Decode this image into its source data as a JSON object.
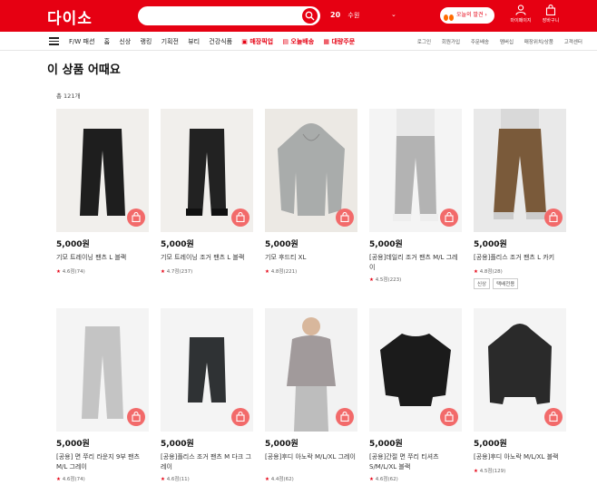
{
  "header": {
    "logo": "다이소",
    "search": {
      "placeholder": ""
    },
    "weather": {
      "temp": "20",
      "location": "수원"
    },
    "promo_label": "오늘의 발견",
    "tools": [
      {
        "label": "마이페이지",
        "icon": "user-icon"
      },
      {
        "label": "장바구니",
        "icon": "bag-icon"
      }
    ]
  },
  "nav": {
    "items": [
      "F/W 패션",
      "홈",
      "신상",
      "랭킹",
      "기획전",
      "뷰티",
      "건강식품"
    ],
    "special": [
      "매장픽업",
      "오늘배송",
      "대량주문"
    ],
    "utility": [
      "로그인",
      "회원가입",
      "주문배송",
      "멤버십",
      "매장위치/상품",
      "고객센터"
    ]
  },
  "section": {
    "title": "이 상품 어때요",
    "count": "총 121개"
  },
  "products": [
    {
      "price": "5,000원",
      "name": "기모 트레이닝 팬츠 L 블랙",
      "rating": "4.6점(74)",
      "image": "black-pants",
      "tags": []
    },
    {
      "price": "5,000원",
      "name": "기모 트레이닝 조거 팬츠 L 블랙",
      "rating": "4.7점(237)",
      "image": "black-jogger",
      "tags": []
    },
    {
      "price": "5,000원",
      "name": "기모 후드티 XL",
      "rating": "4.8점(221)",
      "image": "grey-hoodie",
      "tags": []
    },
    {
      "price": "5,000원",
      "name": "[공용]데일리 조거 팬츠 M/L 그레이",
      "rating": "4.5점(223)",
      "image": "grey-jogger-model",
      "tags": []
    },
    {
      "price": "5,000원",
      "name": "[공용]플리스 조거 팬츠 L 카키",
      "rating": "4.8점(28)",
      "image": "khaki-fleece-model",
      "tags": [
        "신상",
        "택배전용"
      ]
    },
    {
      "price": "5,000원",
      "name": "[공용] 면 쭈리 라운지 9부 팬츠 M/L 그레이",
      "rating": "4.6점(74)",
      "image": "grey-lounge-pants",
      "tags": []
    },
    {
      "price": "5,000원",
      "name": "[공용]플리스 조거 팬츠 M 다크 그레이",
      "rating": "4.6점(11)",
      "image": "dark-fleece-pants",
      "tags": []
    },
    {
      "price": "5,000원",
      "name": "[공용]후디 아노락 M/L/XL 그레이",
      "rating": "4.4점(62)",
      "image": "grey-anorak-model",
      "tags": []
    },
    {
      "price": "5,000원",
      "name": "[공용]간절 면 쭈리 티셔츠 S/M/L/XL 블랙",
      "rating": "4.6점(62)",
      "image": "black-tshirt",
      "tags": []
    },
    {
      "price": "5,000원",
      "name": "[공용]후디 아노락 M/L/XL 블랙",
      "rating": "4.5점(129)",
      "image": "black-anorak",
      "tags": []
    }
  ],
  "colors": {
    "brand": "#e60012",
    "cart": "#f26a6a",
    "star": "#e60012"
  }
}
